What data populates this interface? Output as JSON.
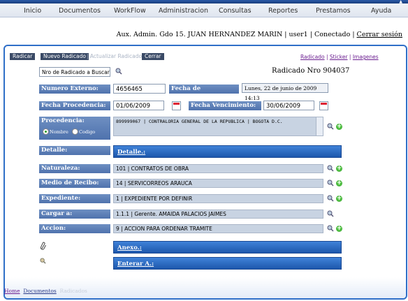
{
  "menu": [
    "Inicio",
    "Documentos",
    "WorkFlow",
    "Administracion",
    "Consultas",
    "Reportes",
    "Prestamos",
    "Ayuda"
  ],
  "user": {
    "line": "Aux. Admin. Gdo 15. JUAN HERNANDEZ MARIN | user1 | Conectado | ",
    "logout": "Cerrar sesión"
  },
  "toolbar": {
    "radicar": "Radicar",
    "nuevo": "Nuevo Radicado",
    "actualizar": "| Actualizar Radicado |",
    "cerrar": "Cerrar"
  },
  "links": {
    "radicado": "Radicado",
    "sticker": "Sticker",
    "imagenes": "Imagenes"
  },
  "search": {
    "placeholder_value": "Nro de Radicado a Buscar",
    "radicado_nro": "Radicado Nro 904037"
  },
  "fields": {
    "numero_externo_label": "Numero Externo:",
    "numero_externo": "4656465",
    "fecha_radicacion_label": "Fecha de Radicacion:",
    "fecha_radicacion": "Lunes, 22 de junio de 2009 14:13",
    "fecha_procedencia_label": "Fecha Procedencia:",
    "fecha_procedencia": "01/06/2009",
    "fecha_vencimiento_label": "Fecha Vencimiento:",
    "fecha_vencimiento": "30/06/2009",
    "procedencia_label": "Procedencia:",
    "procedencia": "899999067 | CONTRALORIA GENERAL DE LA REPUBLICA | BOGOTA D.C.",
    "radio_nombre": "Nombre",
    "radio_codigo": "Codigo",
    "detalle_label": "Detalle:",
    "detalle_section": "Detalle.:",
    "naturaleza_label": "Naturaleza:",
    "naturaleza": "101 | CONTRATOS DE OBRA",
    "medio_label": "Medio de Recibo:",
    "medio": "14 | SERVICORREOS ARAUCA",
    "expediente_label": "Expediente:",
    "expediente": "1 | EXPEDIENTE POR DEFINIR",
    "cargar_label": "Cargar a:",
    "cargar": "1.1.1 | Gerente. AMAIDA PALACIOS JAIMES",
    "accion_label": "Accion:",
    "accion": "9 | ACCION PARA ORDENAR TRAMITE",
    "anexo_section": "Anexo.:",
    "enterar_section": "Enterar A.:"
  },
  "footer": {
    "home": "Home",
    "documentos": "Documentos",
    "radicados": "Radicados"
  }
}
